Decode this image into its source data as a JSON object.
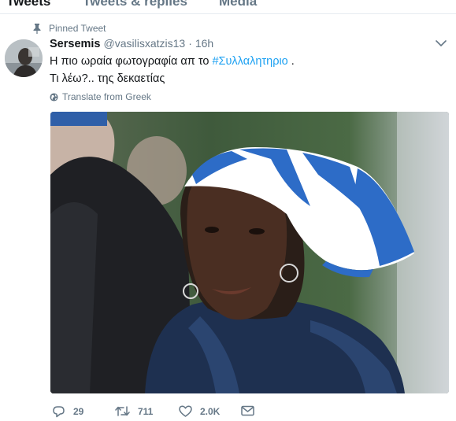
{
  "tabs": [
    {
      "label": "Tweets"
    },
    {
      "label": "Tweets & replies"
    },
    {
      "label": "Media"
    }
  ],
  "pinned_label": "Pinned Tweet",
  "tweet": {
    "name": "Sersemis",
    "handle": "@vasilisxatzis13",
    "separator": "·",
    "time": "16h",
    "text_before_hashtag": "Η πιο ωραία φωτογραφία απ το ",
    "hashtag": "#Συλλαλητηριο",
    "text_after_hashtag": " .",
    "text_line2": "Τι λέω?.. της δεκαετίας",
    "translate_label": "Translate from Greek"
  },
  "actions": {
    "replies": "29",
    "retweets": "711",
    "likes": "2.0K"
  },
  "colors": {
    "accent": "#1da1f2",
    "muted": "#657786",
    "text": "#14171a"
  },
  "icons": {
    "pin": "pin-icon",
    "menu": "chevron-down-icon",
    "translate": "globe-icon",
    "reply": "reply-icon",
    "retweet": "retweet-icon",
    "like": "heart-icon",
    "message": "envelope-icon"
  }
}
